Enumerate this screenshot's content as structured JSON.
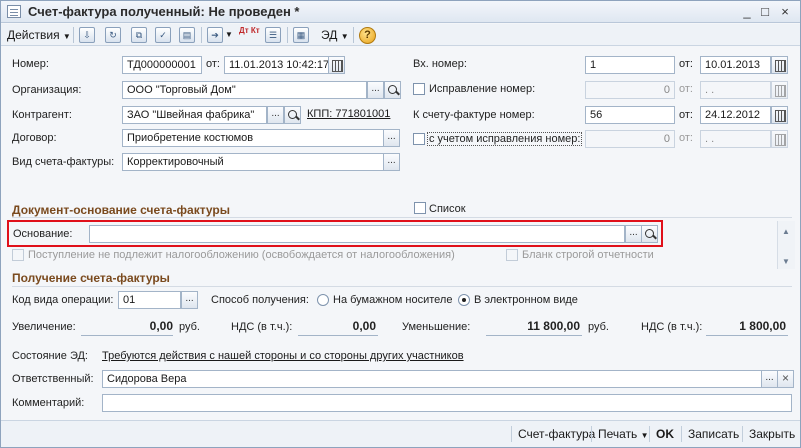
{
  "window": {
    "title": "Счет-фактура полученный: Не проведен *",
    "controls": [
      "_",
      "□",
      "×"
    ]
  },
  "toolbar": {
    "actions_label": "Действия",
    "ed_label": "ЭД",
    "dt_kt_label": "Дт Кт",
    "help_label": "?"
  },
  "fields": {
    "number_label": "Номер:",
    "number_value": "ТД000000001",
    "date_from_label": "от:",
    "date_value": "11.01.2013 10:42:17",
    "org_label": "Организация:",
    "org_value": "ООО \"Торговый Дом\"",
    "contractor_label": "Контрагент:",
    "contractor_value": "ЗАО \"Швейная фабрика\"",
    "kpp_link": "КПП: 771801001",
    "contract_label": "Договор:",
    "contract_value": "Приобретение костюмов",
    "invoice_type_label": "Вид счета-фактуры:",
    "invoice_type_value": "Корректировочный",
    "in_number_label": "Вх. номер:",
    "in_number_value": "1",
    "in_date_from_label": "от:",
    "in_date_value": "10.01.2013",
    "fix_number_label": "Исправление номер:",
    "fix_number_value": "0",
    "fix_from_label": "от:",
    "fix_date_value": ". .",
    "to_invoice_label": "К счету-фактуре номер:",
    "to_invoice_value": "56",
    "to_invoice_from_label": "от:",
    "to_invoice_date": "24.12.2012",
    "with_fix_label": "с учетом исправления номер:",
    "with_fix_value": "0",
    "with_fix_from_label": "от:",
    "with_fix_date": ". ."
  },
  "basis_section": {
    "title": "Документ-основание счета-фактуры",
    "list_label": "Список",
    "basis_label": "Основание:",
    "basis_value": "",
    "not_taxable_label": "Поступление не подлежит налогообложению (освобождается от налогообложения)",
    "strict_form_label": "Бланк строгой отчетности"
  },
  "receipt_section": {
    "title": "Получение счета-фактуры",
    "op_code_label": "Код вида операции:",
    "op_code_value": "01",
    "method_label": "Способ получения:",
    "paper_label": "На бумажном носителе",
    "electronic_label": "В электронном виде",
    "electronic_selected": true,
    "increase_label": "Увеличение:",
    "increase_value": "0,00",
    "increase_currency": "руб.",
    "vat_inc_label": "НДС (в т.ч.):",
    "vat_inc_value": "0,00",
    "decrease_label": "Уменьшение:",
    "decrease_value": "11 800,00",
    "decrease_currency": "руб.",
    "vat_dec_label": "НДС (в т.ч.):",
    "vat_dec_value": "1 800,00"
  },
  "footer_fields": {
    "ed_state_label": "Состояние ЭД:",
    "ed_state_link": "Требуются действия с нашей стороны и со стороны других участников",
    "responsible_label": "Ответственный:",
    "responsible_value": "Сидорова Вера",
    "comment_label": "Комментарий:",
    "comment_value": ""
  },
  "bottombar": {
    "invoice_label": "Счет-фактура",
    "print_label": "Печать",
    "ok_label": "OK",
    "save_label": "Записать",
    "close_label": "Закрыть"
  },
  "colors": {
    "highlight": "#e0101a",
    "section_title": "#7a4a1e",
    "border": "#a3b4c8"
  }
}
